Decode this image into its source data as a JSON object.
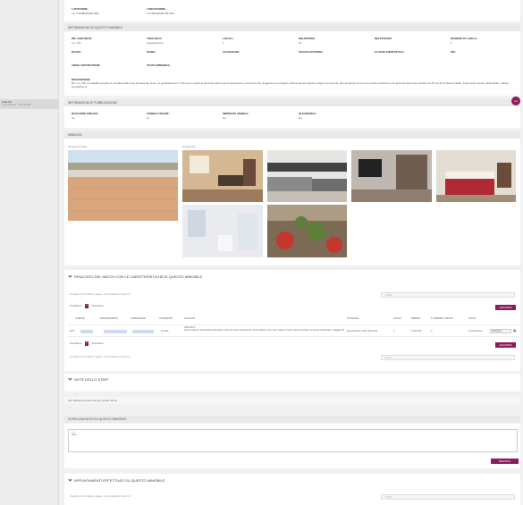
{
  "sidebar": {
    "item_title": "Gaia 58",
    "item_sub": "Le tue richieste · tutti i tuoi dati"
  },
  "top": {
    "row0_vals": [
      "",
      "",
      "",
      "",
      ""
    ],
    "lat_label": "LATITUDINE:",
    "lat_value": "41.7760885508801833",
    "lng_label": "LONGITUDINE:",
    "lng_value": "12.6658285841891782"
  },
  "info_section": {
    "title": "Informazioni su questo immobile",
    "fields": [
      {
        "label": "Rif. annuncio:",
        "value": "LA_741"
      },
      {
        "label": "Tipologia:",
        "value": "Appartamento"
      },
      {
        "label": "Locali:",
        "value": "2"
      },
      {
        "label": "MQ interni:",
        "value": "44"
      },
      {
        "label": "MQ esterni:",
        "value": ""
      },
      {
        "label": "Numero di livelli:",
        "value": "1"
      },
      {
        "label": "Bagni:",
        "value": ""
      },
      {
        "label": "Piano:",
        "value": ""
      },
      {
        "label": "Accessori:",
        "value": ""
      },
      {
        "label": "Spazio esterno:",
        "value": ""
      },
      {
        "label": "Classe energetica:",
        "value": ""
      },
      {
        "label": "IPE:",
        "value": ""
      },
      {
        "label": "Anno costruzione:",
        "value": ""
      },
      {
        "label": "Stato immobile:",
        "value": ""
      }
    ],
    "desc_label": "Descrizione:",
    "desc_text": "Rif. LA_741 La Casa84 propone in vendita nella zona di Casa dei venti, un appartamento in 45 mq 1 e posto al secondo piano senza ascensore e composto da: Soggiorno con angolo cottura camera doppia, bagno con doccia, due terrazzini di cui uno al piano superiore con accesso dal primo terrazzo di 45 mq di cui Buone Stato. Posto auto coperto disponibile. Classe energetica G."
  },
  "pub_section": {
    "title": "Informazioni di pubblicazione",
    "fields": [
      {
        "label": "Nascondi prezzo:",
        "value": "No"
      },
      {
        "label": "Visibile online:",
        "value": "Sì"
      },
      {
        "label": "Indirizzo visibile:",
        "value": "No"
      },
      {
        "label": "In evidenza:",
        "value": "No"
      }
    ],
    "action_label": "ok"
  },
  "images_section": {
    "title": "Immagini",
    "main_caption": "Immagine principale",
    "others_caption": "Immagini altre"
  },
  "match_section": {
    "title": "Risultato del match con le caratteristiche di questo immobile",
    "per_page_text": "Visualizza 10 ▾ risultati per pagina · Non visualizzare 0 righe 0 d",
    "filter_placeholder": "Filtra",
    "refresh_label": "AGGIORNA",
    "prev_label": "Precedente",
    "page": "1",
    "next_label": "Successivo",
    "columns": [
      "Cliente",
      "Data richiesta",
      "Consulente",
      "Contratto",
      "Località",
      "Tipologia",
      "Locali",
      "Prezzo",
      "N. immobili visitati",
      "Stato"
    ],
    "row": {
      "id": "#247",
      "contract": "Vendita",
      "location": "Villa Marzo\nRoma Frascati, Santa Maria delle Mole, Casa dei Venti, Castelluccia, Fonte Ranieri, Due Santi, Marino Centro, Rocca di Papa, Cecchina, Frattocchie, Villaggio Ati",
      "type": "Appartamento, Villa, Mansarda",
      "rooms": "2",
      "price": "€ 160.000",
      "visited": "0",
      "status": "In lavorazione",
      "select_value": "Seleziona"
    }
  },
  "staff_section": {
    "title": "Note dello staff",
    "empty_text": "Non abbiamo ancora note per questo cliente."
  },
  "write_note": {
    "title": "Scrivi una nota su questo immobile",
    "field_label": "Note",
    "field_value": "Note",
    "save_label": "REGISTRA"
  },
  "appointments": {
    "title": "Appuntamenti effettuati su questo immobile",
    "per_page_text": "Visualizza 10 ▾ risultati per pagina · Non visualizzare 0 righe 0 d",
    "filter_placeholder": "Filtra"
  }
}
